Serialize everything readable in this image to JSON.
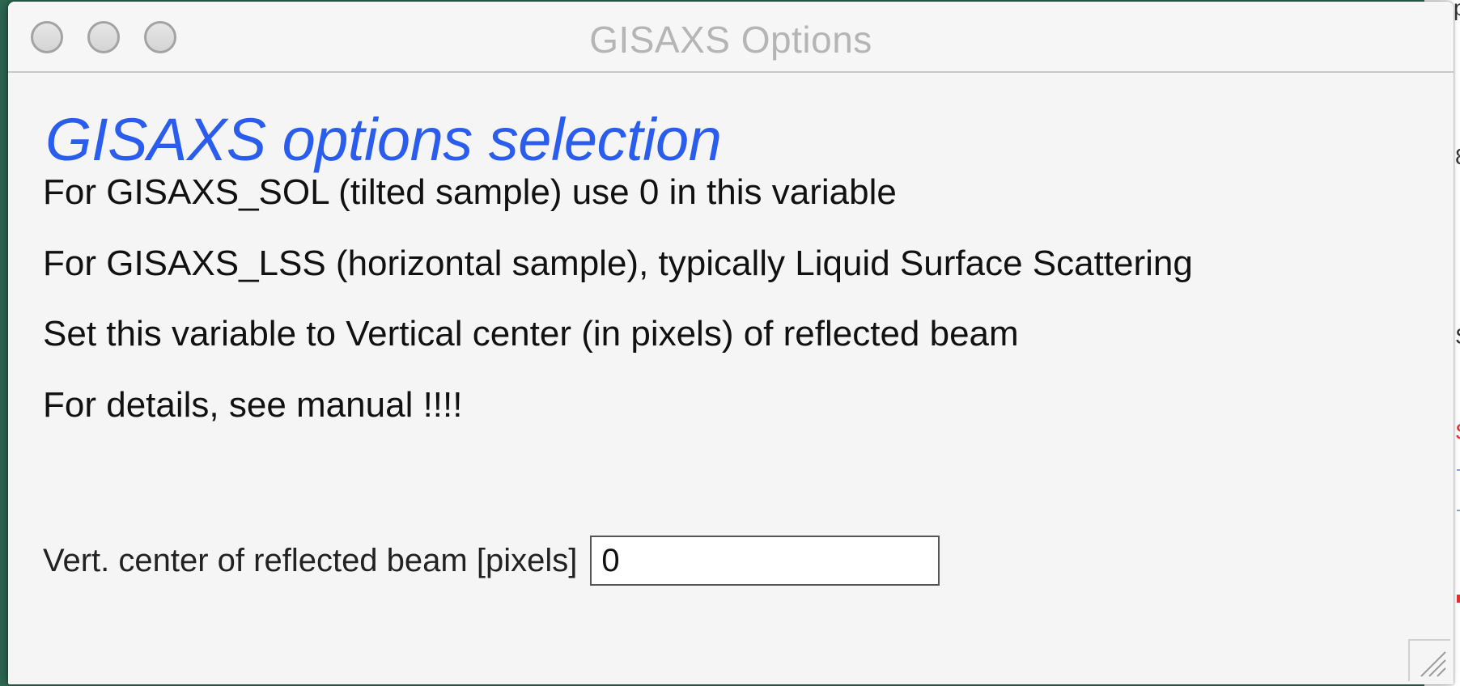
{
  "window": {
    "title": "GISAXS Options",
    "buttons": [
      "close",
      "minimize",
      "zoom"
    ]
  },
  "content": {
    "heading": "GISAXS options selection",
    "lines": [
      "For GISAXS_SOL (tilted sample) use 0 in this variable",
      "For GISAXS_LSS (horizontal sample), typically Liquid Surface Scattering",
      "Set this variable to Vertical center (in pixels) of reflected beam",
      "For details, see manual !!!!"
    ],
    "field": {
      "label": "Vert. center of reflected beam [pixels]",
      "value": "0"
    }
  },
  "colors": {
    "heading": "#2a5ded",
    "title_text": "#b5b5b5",
    "window_bg": "#f5f5f5"
  }
}
